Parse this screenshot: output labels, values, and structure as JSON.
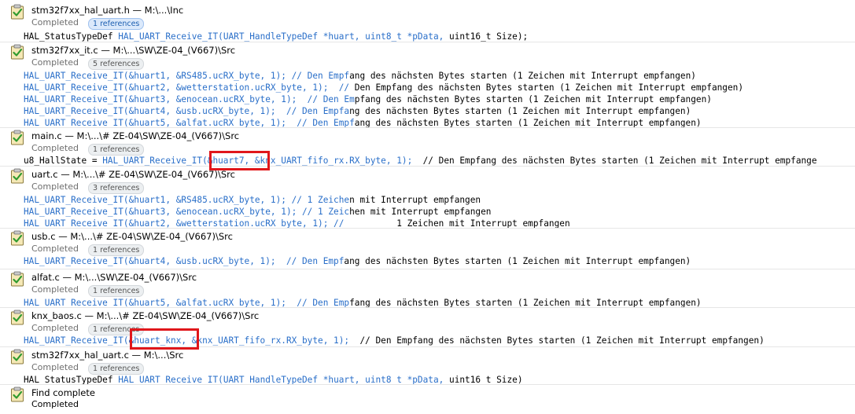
{
  "groups": [
    {
      "file": "stm32f7xx_hal_uart.h — M:\\...\\Inc",
      "status": "Completed",
      "refs": "1 references",
      "lines": [
        {
          "b": "HAL_StatusTypeDef ",
          "blue": "HAL_UART_Receive_IT(UART_HandleTypeDef *huart, uint8_t *pData, ",
          "a": "uint16_t Size);"
        }
      ]
    },
    {
      "file": "stm32f7xx_it.c — M:\\...\\SW\\ZE-04_(V667)\\Src",
      "status": "Completed",
      "refs": "5 references",
      "lines": [
        {
          "blue": "HAL_UART_Receive_IT(&huart1, &RS485.ucRX_byte, 1); // Den Empf",
          "a": "ang des nächsten Bytes starten (1 Zeichen mit Interrupt empfangen)"
        },
        {
          "blue": "HAL_UART_Receive_IT(&huart2, &wetterstation.ucRX_byte, 1);  // ",
          "a": "Den Empfang des nächsten Bytes starten (1 Zeichen mit Interrupt empfangen)"
        },
        {
          "blue": "HAL_UART_Receive_IT(&huart3, &enocean.ucRX_byte, 1);  // Den Em",
          "a": "pfang des nächsten Bytes starten (1 Zeichen mit Interrupt empfangen)"
        },
        {
          "blue": "HAL_UART_Receive_IT(&huart4, &usb.ucRX_byte, 1);  // Den Empfa",
          "a": "ng des nächsten Bytes starten (1 Zeichen mit Interrupt empfangen)"
        },
        {
          "blue": "HAL_UART_Receive_IT(&huart5, &alfat.ucRX_byte, 1);  // Den Empf",
          "a": "ang des nächsten Bytes starten (1 Zeichen mit Interrupt empfangen)"
        }
      ]
    },
    {
      "file": "main.c — M:\\...\\# ZE-04\\SW\\ZE-04_(V667)\\Src",
      "status": "Completed",
      "refs": "1 references",
      "lines": [
        {
          "b": "u8_HallState = ",
          "blue": "HAL_UART_Receive_IT(&huart7, &knx_UART_fifo_rx.RX_byte, 1);",
          "a": "  // Den Empfang des nächsten Bytes starten (1 Zeichen mit Interrupt empfange"
        }
      ]
    },
    {
      "file": "uart.c — M:\\...\\# ZE-04\\SW\\ZE-04_(V667)\\Src",
      "status": "Completed",
      "refs": "3 references",
      "lines": [
        {
          "blue": "HAL_UART_Receive_IT(&huart1, &RS485.ucRX_byte, 1); // 1 Zeiche",
          "a": "n mit Interrupt empfangen"
        },
        {
          "blue": "HAL_UART_Receive_IT(&huart3, &enocean.ucRX_byte, 1); // 1 Zeic",
          "a": "hen mit Interrupt empfangen"
        },
        {
          "blue": "HAL_UART_Receive_IT(&huart2, &wetterstation.ucRX_byte, 1); //",
          "a": "          1 Zeichen mit Interrupt empfangen"
        }
      ]
    },
    {
      "file": "usb.c — M:\\...\\# ZE-04\\SW\\ZE-04_(V667)\\Src",
      "status": "Completed",
      "refs": "1 references",
      "lines": [
        {
          "blue": "HAL_UART_Receive_IT(&huart4, &usb.ucRX_byte, 1);  // Den Empf",
          "a": "ang des nächsten Bytes starten (1 Zeichen mit Interrupt empfangen)"
        }
      ]
    },
    {
      "file": "alfat.c — M:\\...\\SW\\ZE-04_(V667)\\Src",
      "status": "Completed",
      "refs": "1 references",
      "lines": [
        {
          "blue": "HAL_UART_Receive_IT(&huart5, &alfat.ucRX_byte, 1);  // Den Emp",
          "a": "fang des nächsten Bytes starten (1 Zeichen mit Interrupt empfangen)"
        }
      ]
    },
    {
      "file": "knx_baos.c — M:\\...\\# ZE-04\\SW\\ZE-04_(V667)\\Src",
      "status": "Completed",
      "refs": "1 references",
      "lines": [
        {
          "blue": "HAL_UART_Receive_IT(&huart_knx, &knx_UART_fifo_rx.RX_byte, 1);",
          "a": "  // Den Empfang des nächsten Bytes starten (1 Zeichen mit Interrupt empfangen)"
        }
      ]
    },
    {
      "file": "stm32f7xx_hal_uart.c — M:\\...\\Src",
      "status": "Completed",
      "refs": "1 references",
      "lines": [
        {
          "b": "HAL_StatusTypeDef ",
          "blue": "HAL_UART_Receive_IT(UART_HandleTypeDef *huart, uint8_t *pData, ",
          "a": "uint16_t Size)"
        }
      ]
    }
  ],
  "footer": {
    "title": "Find complete",
    "status": "Completed"
  },
  "colors": {
    "code_blue": "#2a6fc9",
    "highlight_red": "#e0171b",
    "badge_bg": "#eceff1"
  },
  "icons": {
    "status": "clipboard-check-icon"
  }
}
